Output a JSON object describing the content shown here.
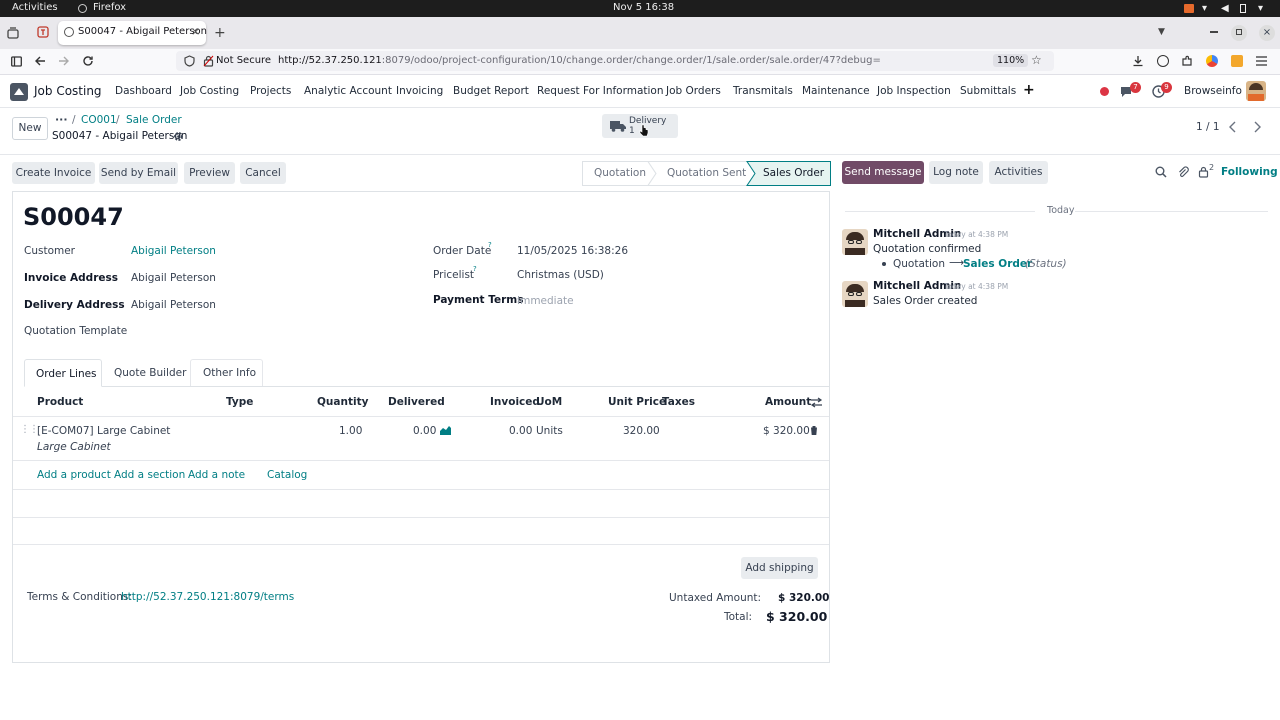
{
  "os": {
    "activities": "Activities",
    "app": "Firefox",
    "clock": "Nov 5  16:38"
  },
  "browser": {
    "tab_title": "S00047 - Abigail Peterson",
    "not_secure": "Not Secure",
    "url_host": "http://52.37.250.121",
    "url_path": ":8079/odoo/project-configuration/10/change.order/change.order/1/sale.order/sale.order/47?debug=",
    "zoom": "110%"
  },
  "odoo": {
    "app_name": "Job Costing",
    "menu": [
      "Dashboard",
      "Job Costing",
      "Projects",
      "Analytic Account",
      "Invoicing",
      "Budget Report",
      "Request For Information",
      "Job Orders",
      "Transmitals",
      "Maintenance",
      "Job Inspection",
      "Submittals"
    ],
    "messages_count": "7",
    "activities_count": "9",
    "company": "Browseinfo"
  },
  "control_panel": {
    "new_label": "New",
    "breadcrumb_dots": "···",
    "breadcrumb": [
      "CO001",
      "Sale Order"
    ],
    "record_title": "S00047 - Abigail Peterson",
    "smart_button": {
      "label": "Delivery",
      "count": "1"
    },
    "pager": "1 / 1"
  },
  "actions": [
    "Create Invoice",
    "Send by Email",
    "Preview",
    "Cancel"
  ],
  "statusbar": [
    "Quotation",
    "Quotation Sent",
    "Sales Order"
  ],
  "chatter_buttons": {
    "send": "Send message",
    "log": "Log note",
    "activities": "Activities",
    "followers_count": "2",
    "following": "Following"
  },
  "form": {
    "name": "S00047",
    "customer_label": "Customer",
    "customer": "Abigail Peterson",
    "invoice_label": "Invoice Address",
    "invoice": "Abigail Peterson",
    "delivery_label": "Delivery Address",
    "delivery": "Abigail Peterson",
    "template_label": "Quotation Template",
    "order_date_label": "Order Date",
    "order_date": "11/05/2025 16:38:26",
    "pricelist_label": "Pricelist",
    "pricelist": "Christmas (USD)",
    "payment_terms_label": "Payment Terms",
    "payment_terms": "Immediate",
    "help_mark": "?"
  },
  "tabs": [
    "Order Lines",
    "Quote Builder",
    "Other Info"
  ],
  "table": {
    "headers": [
      "Product",
      "Type",
      "Quantity",
      "Delivered",
      "Invoiced",
      "UoM",
      "Unit Price",
      "Taxes",
      "Amount"
    ],
    "rows": [
      {
        "product": "[E-COM07] Large Cabinet",
        "description": "Large Cabinet",
        "type": "",
        "quantity": "1.00",
        "delivered": "0.00",
        "invoiced": "0.00",
        "uom": "Units",
        "unit_price": "320.00",
        "taxes": "",
        "amount": "$ 320.00"
      }
    ],
    "add_links": [
      "Add a product",
      "Add a section",
      "Add a note",
      "Catalog"
    ]
  },
  "footer": {
    "add_shipping": "Add shipping",
    "terms_label": "Terms & Conditions:",
    "terms_link": "http://52.37.250.121:8079/terms",
    "untaxed_label": "Untaxed Amount:",
    "untaxed": "$ 320.00",
    "total_label": "Total:",
    "total": "$ 320.00"
  },
  "chatter": {
    "date_separator": "Today",
    "messages": [
      {
        "author": "Mitchell Admin",
        "time": "Today at 4:38 PM",
        "body": "Quotation confirmed",
        "tracking_old": "Quotation",
        "tracking_arrow": "⟶",
        "tracking_new": "Sales Order",
        "tracking_field": "(Status)"
      },
      {
        "author": "Mitchell Admin",
        "time": "Today at 4:38 PM",
        "body": "Sales Order created"
      }
    ]
  },
  "colors": {
    "brand": "#714b67",
    "link": "#017e84",
    "active_status": "#e6f4f1"
  }
}
